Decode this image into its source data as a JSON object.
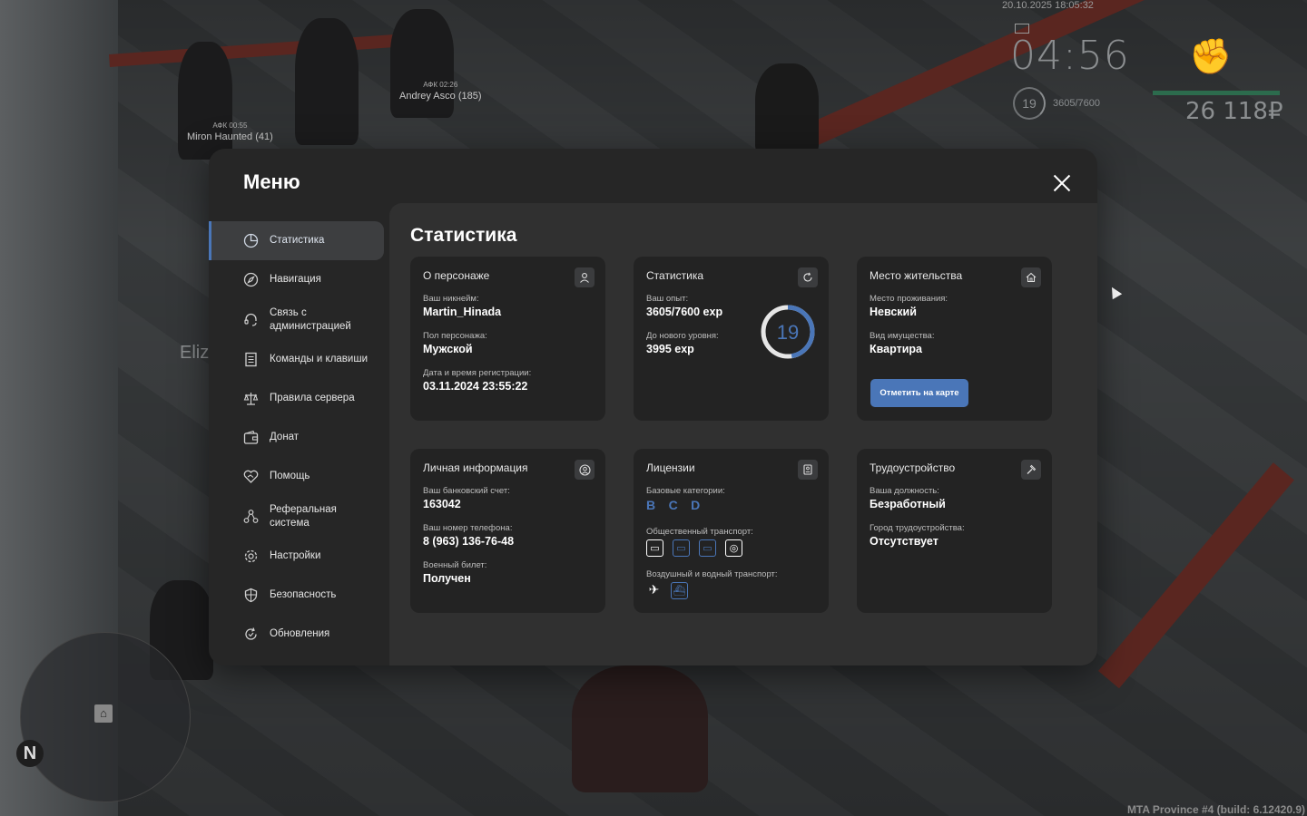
{
  "hud": {
    "datetime": "20.10.2025 18:05:32",
    "clock": "04:56",
    "level": "19",
    "exp": "3605/7600",
    "money": "26 118₽",
    "bg_name": "Eliz",
    "build": "MTA Province #4 (build: 6.12420.9)",
    "north": "N"
  },
  "nametags": [
    {
      "afk": "АФК 02:26",
      "name": "Andrey Asco (185)"
    },
    {
      "afk": "АФК 00:55",
      "name": "Miron Haunted (41)"
    }
  ],
  "menu": {
    "title": "Меню",
    "items": [
      {
        "label": "Статистика",
        "icon": "pie-chart-icon"
      },
      {
        "label": "Навигация",
        "icon": "compass-icon"
      },
      {
        "label": "Связь с администрацией",
        "icon": "headset-icon"
      },
      {
        "label": "Команды и клавиши",
        "icon": "list-icon"
      },
      {
        "label": "Правила сервера",
        "icon": "scales-icon"
      },
      {
        "label": "Донат",
        "icon": "wallet-icon"
      },
      {
        "label": "Помощь",
        "icon": "handshake-icon"
      },
      {
        "label": "Реферальная система",
        "icon": "referral-icon"
      },
      {
        "label": "Настройки",
        "icon": "gear-icon"
      },
      {
        "label": "Безопасность",
        "icon": "shield-icon"
      },
      {
        "label": "Обновления",
        "icon": "refresh-icon"
      }
    ]
  },
  "content": {
    "title": "Статистика",
    "character": {
      "title": "О персонаже",
      "nickname_label": "Ваш никнейм:",
      "nickname": "Martin_Hinada",
      "gender_label": "Пол персонажа:",
      "gender": "Мужской",
      "reg_label": "Дата и время регистрации:",
      "reg": "03.11.2024 23:55:22"
    },
    "stats": {
      "title": "Статистика",
      "exp_label": "Ваш опыт:",
      "exp": "3605/7600 exp",
      "next_label": "До нового уровня:",
      "next": "3995 exp",
      "level": "19",
      "progress": 0.4743
    },
    "residence": {
      "title": "Место жительства",
      "place_label": "Место проживания:",
      "place": "Невский",
      "property_label": "Вид имущества:",
      "property": "Квартира",
      "button": "Отметить на карте"
    },
    "personal": {
      "title": "Личная информация",
      "bank_label": "Ваш банковский счет:",
      "bank": "163042",
      "phone_label": "Ваш номер телефона:",
      "phone": "8 (963) 136-76-48",
      "military_label": "Военный билет:",
      "military": "Получен"
    },
    "licenses": {
      "title": "Лицензии",
      "base_label": "Базовые категории:",
      "base": [
        "B",
        "C",
        "D"
      ],
      "public_label": "Общественный транспорт:",
      "air_label": "Воздушный и водный транспорт:"
    },
    "job": {
      "title": "Трудоустройство",
      "position_label": "Ваша должность:",
      "position": "Безработный",
      "city_label": "Город трудоустройства:",
      "city": "Отсутствует"
    }
  },
  "colors": {
    "accent": "#4a76b8",
    "card": "#232323",
    "panel": "#303030"
  }
}
